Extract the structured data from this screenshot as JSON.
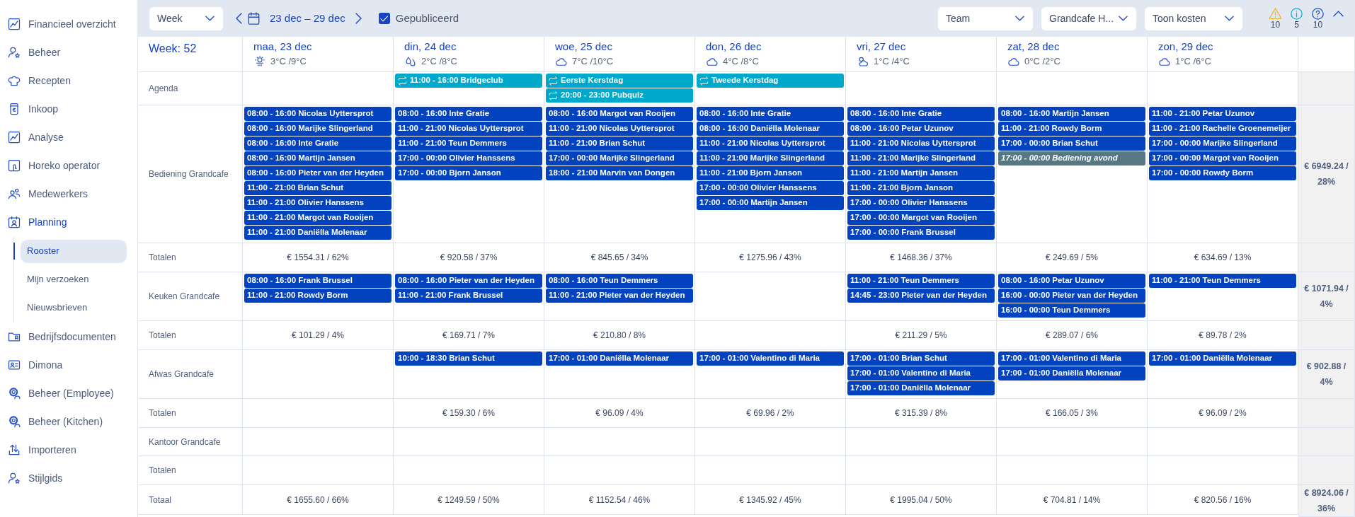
{
  "sidebar": {
    "items": [
      {
        "label": "Financieel overzicht",
        "kind": "chart",
        "selected": false
      },
      {
        "label": "Beheer",
        "kind": "user-star",
        "selected": false
      },
      {
        "label": "Recepten",
        "kind": "hat",
        "selected": false
      },
      {
        "label": "Inkoop",
        "kind": "receipt",
        "selected": false
      },
      {
        "label": "Analyse",
        "kind": "chart",
        "selected": false
      },
      {
        "label": "Horeko operator",
        "kind": "touch",
        "selected": false
      },
      {
        "label": "Medewerkers",
        "kind": "users",
        "selected": false
      },
      {
        "label": "Planning",
        "kind": "calendar",
        "selected": true,
        "children": [
          {
            "label": "Rooster",
            "selected": true
          },
          {
            "label": "Mijn verzoeken",
            "selected": false
          },
          {
            "label": "Nieuwsbrieven",
            "selected": false
          }
        ]
      },
      {
        "label": "Bedrijfsdocumenten",
        "kind": "folder",
        "selected": false
      },
      {
        "label": "Dimona",
        "kind": "id-card",
        "selected": false
      },
      {
        "label": "Beheer (Employee)",
        "kind": "gear",
        "selected": false
      },
      {
        "label": "Beheer (Kitchen)",
        "kind": "gear",
        "selected": false
      },
      {
        "label": "Importeren",
        "kind": "upload",
        "selected": false
      },
      {
        "label": "Stijlgids",
        "kind": "user-star",
        "selected": false
      }
    ]
  },
  "toolbar": {
    "view_select": "Week",
    "date_range": "23 dec – 29 dec",
    "published": {
      "label": "Gepubliceerd",
      "checked": true
    },
    "filters": [
      "Team",
      "Grandcafe H...",
      "Toon kosten"
    ],
    "alerts": [
      {
        "kind": "warning",
        "count": "10"
      },
      {
        "kind": "info",
        "count": "5"
      },
      {
        "kind": "help",
        "count": "10"
      }
    ]
  },
  "header": {
    "week_label": "Week: 52",
    "agenda_label": "Agenda",
    "days": [
      {
        "label": "maa, 23 dec",
        "kind": "sun-rain",
        "temperature": "3°C /9°C"
      },
      {
        "label": "din, 24 dec",
        "kind": "rain",
        "temperature": "2°C /8°C",
        "agenda": [
          {
            "label": "11:00 - 16:00 Bridgeclub"
          }
        ]
      },
      {
        "label": "woe, 25 dec",
        "kind": "cloud",
        "temperature": "7°C /10°C",
        "agenda": [
          {
            "label": "Eerste Kerstdag"
          },
          {
            "label": "20:00 - 23:00 Pubquiz"
          }
        ]
      },
      {
        "label": "don, 26 dec",
        "kind": "cloud",
        "temperature": "4°C /8°C",
        "agenda": [
          {
            "label": "Tweede Kerstdag"
          }
        ]
      },
      {
        "label": "vri, 27 dec",
        "kind": "sun-cloud",
        "temperature": "1°C /4°C"
      },
      {
        "label": "zat, 28 dec",
        "kind": "cloud",
        "temperature": "0°C /2°C"
      },
      {
        "label": "zon, 29 dec",
        "kind": "cloud",
        "temperature": "1°C /6°C"
      }
    ]
  },
  "sections": [
    {
      "name": "Bediening Grandcafe",
      "total": "€ 6949.24 / 28%",
      "totals_label": "Totalen",
      "days": [
        {
          "cost": "€ 1554.31 / 62%",
          "shifts": [
            {
              "label": "08:00 - 16:00 Nicolas Uyttersprot",
              "kind": "shift"
            },
            {
              "label": "08:00 - 16:00 Marijke Slingerland",
              "kind": "shift"
            },
            {
              "label": "08:00 - 16:00 Inte Gratie",
              "kind": "shift"
            },
            {
              "label": "08:00 - 16:00 Martijn Jansen",
              "kind": "shift"
            },
            {
              "label": "08:00 - 16:00 Pieter van der Heyden",
              "kind": "shift"
            },
            {
              "label": "11:00 - 21:00 Brian Schut",
              "kind": "shift"
            },
            {
              "label": "11:00 - 21:00 Olivier Hanssens",
              "kind": "shift"
            },
            {
              "label": "11:00 - 21:00 Margot van Rooijen",
              "kind": "shift"
            },
            {
              "label": "11:00 - 21:00 Daniëlla Molenaar",
              "kind": "shift"
            }
          ]
        },
        {
          "cost": "€ 920.58 / 37%",
          "shifts": [
            {
              "label": "08:00 - 16:00 Inte Gratie",
              "kind": "shift"
            },
            {
              "label": "11:00 - 21:00 Nicolas Uyttersprot",
              "kind": "shift"
            },
            {
              "label": "11:00 - 21:00 Teun Demmers",
              "kind": "shift"
            },
            {
              "label": "17:00 - 00:00 Olivier Hanssens",
              "kind": "shift"
            },
            {
              "label": "17:00 - 00:00 Bjorn Janson",
              "kind": "shift"
            }
          ]
        },
        {
          "cost": "€ 845.65 / 34%",
          "shifts": [
            {
              "label": "08:00 - 16:00 Margot van Rooijen",
              "kind": "shift"
            },
            {
              "label": "11:00 - 21:00 Nicolas Uyttersprot",
              "kind": "shift"
            },
            {
              "label": "11:00 - 21:00 Brian Schut",
              "kind": "shift"
            },
            {
              "label": "17:00 - 00:00 Marijke Slingerland",
              "kind": "shift"
            },
            {
              "label": "18:00 - 21:00 Marvin van Dongen",
              "kind": "shift"
            }
          ]
        },
        {
          "cost": "€ 1275.96 / 43%",
          "shifts": [
            {
              "label": "08:00 - 16:00 Inte Gratie",
              "kind": "shift"
            },
            {
              "label": "08:00 - 16:00 Daniëlla Molenaar",
              "kind": "shift"
            },
            {
              "label": "11:00 - 21:00 Nicolas Uyttersprot",
              "kind": "shift"
            },
            {
              "label": "11:00 - 21:00 Marijke Slingerland",
              "kind": "shift"
            },
            {
              "label": "11:00 - 21:00 Bjorn Janson",
              "kind": "shift"
            },
            {
              "label": "17:00 - 00:00 Olivier Hanssens",
              "kind": "shift"
            },
            {
              "label": "17:00 - 00:00 Martijn Jansen",
              "kind": "shift"
            }
          ]
        },
        {
          "cost": "€ 1468.36 / 37%",
          "shifts": [
            {
              "label": "08:00 - 16:00 Inte Gratie",
              "kind": "shift"
            },
            {
              "label": "08:00 - 16:00 Petar Uzunov",
              "kind": "shift"
            },
            {
              "label": "11:00 - 21:00 Nicolas Uyttersprot",
              "kind": "shift"
            },
            {
              "label": "11:00 - 21:00 Marijke Slingerland",
              "kind": "shift"
            },
            {
              "label": "11:00 - 21:00 Martijn Jansen",
              "kind": "shift"
            },
            {
              "label": "11:00 - 21:00 Bjorn Janson",
              "kind": "shift"
            },
            {
              "label": "17:00 - 00:00 Olivier Hanssens",
              "kind": "shift"
            },
            {
              "label": "17:00 - 00:00 Margot van Rooijen",
              "kind": "shift"
            },
            {
              "label": "17:00 - 00:00 Frank Brussel",
              "kind": "shift"
            }
          ]
        },
        {
          "cost": "€ 249.69 / 5%",
          "shifts": [
            {
              "label": "08:00 - 16:00 Martijn Jansen",
              "kind": "shift"
            },
            {
              "label": "11:00 - 21:00 Rowdy Borm",
              "kind": "shift"
            },
            {
              "label": "17:00 - 00:00 Brian Schut",
              "kind": "shift"
            },
            {
              "label": "17:00 - 00:00 Bediening avond",
              "kind": "open"
            }
          ]
        },
        {
          "cost": "€ 634.69 / 13%",
          "shifts": [
            {
              "label": "11:00 - 21:00 Petar Uzunov",
              "kind": "shift"
            },
            {
              "label": "11:00 - 21:00 Rachelle Groenemeijer",
              "kind": "shift"
            },
            {
              "label": "17:00 - 00:00 Marijke Slingerland",
              "kind": "shift"
            },
            {
              "label": "17:00 - 00:00 Margot van Rooijen",
              "kind": "shift"
            },
            {
              "label": "17:00 - 00:00 Rowdy Borm",
              "kind": "shift"
            }
          ]
        }
      ]
    },
    {
      "name": "Keuken Grandcafe",
      "total": "€ 1071.94 / 4%",
      "totals_label": "Totalen",
      "day_cells": {
        "day_1": {
          "cost": "€ 101.29 / 4%",
          "shifts": [
            {
              "label": "08:00 - 16:00 Frank Brussel",
              "kind": "shift"
            },
            {
              "label": "11:00 - 21:00 Rowdy Borm",
              "kind": "shift"
            }
          ]
        },
        "day_2": {
          "cost": "€ 169.71 / 7%",
          "shifts": [
            {
              "label": "08:00 - 16:00 Pieter van der Heyden",
              "kind": "shift"
            },
            {
              "label": "11:00 - 21:00 Frank Brussel",
              "kind": "shift"
            }
          ]
        },
        "day_3": {
          "cost": "€ 210.80 / 8%",
          "shifts": [
            {
              "label": "08:00 - 16:00 Teun Demmers",
              "kind": "shift"
            },
            {
              "label": "11:00 - 21:00 Pieter van der Heyden",
              "kind": "shift"
            }
          ]
        },
        "day_5": {
          "cost": "€ 211.29 / 5%",
          "shifts": [
            {
              "label": "11:00 - 21:00 Teun Demmers",
              "kind": "shift"
            },
            {
              "label": "14:45 - 23:00 Pieter van der Heyden",
              "kind": "shift"
            }
          ]
        },
        "day_6": {
          "cost": "€ 289.07 / 6%",
          "shifts": [
            {
              "label": "08:00 - 16:00 Petar Uzunov",
              "kind": "shift"
            },
            {
              "label": "16:00 - 00:00 Pieter van der Heyden",
              "kind": "shift"
            },
            {
              "label": "16:00 - 00:00 Teun Demmers",
              "kind": "shift"
            }
          ]
        },
        "day_7": {
          "cost": "€ 89.78 / 2%",
          "shifts": [
            {
              "label": "11:00 - 21:00 Teun Demmers",
              "kind": "shift"
            }
          ]
        }
      }
    },
    {
      "name": "Afwas Grandcafe",
      "total": "€ 902.88 / 4%",
      "totals_label": "Totalen",
      "day_cells": {
        "day_2": {
          "cost": "€ 159.30 / 6%",
          "shifts": [
            {
              "label": "10:00 - 18:30 Brian Schut",
              "kind": "shift"
            }
          ]
        },
        "day_3": {
          "cost": "€ 96.09 / 4%",
          "shifts": [
            {
              "label": "17:00 - 01:00 Daniëlla Molenaar",
              "kind": "shift"
            }
          ]
        },
        "day_4": {
          "cost": "€ 69.96 / 2%",
          "shifts": [
            {
              "label": "17:00 - 01:00 Valentino di Maria",
              "kind": "shift"
            }
          ]
        },
        "day_5": {
          "cost": "€ 315.39 / 8%",
          "shifts": [
            {
              "label": "17:00 - 01:00 Brian Schut",
              "kind": "shift"
            },
            {
              "label": "17:00 - 01:00 Valentino di Maria",
              "kind": "shift"
            },
            {
              "label": "17:00 - 01:00 Daniëlla Molenaar",
              "kind": "shift"
            }
          ]
        },
        "day_6": {
          "cost": "€ 166.05 / 3%",
          "shifts": [
            {
              "label": "17:00 - 01:00 Valentino di Maria",
              "kind": "shift"
            },
            {
              "label": "17:00 - 01:00 Daniëlla Molenaar",
              "kind": "shift"
            }
          ]
        },
        "day_7": {
          "cost": "€ 96.09 / 2%",
          "shifts": [
            {
              "label": "17:00 - 01:00 Daniëlla Molenaar",
              "kind": "shift"
            }
          ]
        }
      }
    },
    {
      "name": "Kantoor Grandcafe",
      "totals_label": "Totalen"
    }
  ],
  "grand_total": {
    "label": "Totaal",
    "values": [
      "€ 1655.60 / 66%",
      "€ 1249.59 / 50%",
      "€ 1152.54 / 46%",
      "€ 1345.92 / 45%",
      "€ 1995.04 / 50%",
      "€ 704.81 / 14%",
      "€ 820.56 / 16%"
    ],
    "total": "€ 8924.06 / 36%"
  }
}
